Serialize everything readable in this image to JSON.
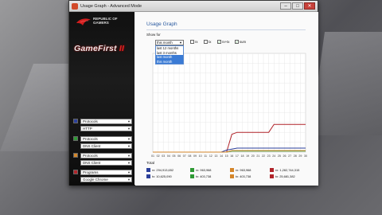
{
  "window": {
    "title": "Usage Graph - Advanced Mode",
    "minimize": "–",
    "maximize": "□",
    "close": "✕"
  },
  "brand": {
    "line1": "REPUBLIC OF",
    "line2": "GAMERS",
    "product": "GameFirst",
    "product_suffix": "II"
  },
  "slots": [
    {
      "color": "#2b3f9a",
      "category": "Protocols",
      "item": "HTTP"
    },
    {
      "color": "#2f9a35",
      "category": "Protocols",
      "item": "DNS Client"
    },
    {
      "color": "#d4862a",
      "category": "Protocols",
      "item": "DNS Client"
    },
    {
      "color": "#b0242a",
      "category": "Programs",
      "item": "Google Chrome"
    }
  ],
  "main": {
    "heading": "Usage Graph",
    "show_for": "Show for",
    "period_selected": "this month",
    "period_options": [
      "last 12 months",
      "last 3 months",
      "last month",
      "this month"
    ],
    "checkboxes": [
      {
        "label": "rx",
        "checked": false
      },
      {
        "label": "tx",
        "checked": false
      },
      {
        "label": "rx+tx",
        "checked": true
      },
      {
        "label": "sum",
        "checked": true
      }
    ],
    "total_label": "Total",
    "totals": [
      {
        "color": "#2b3f9a",
        "rx": "rx: 294,913,652",
        "tx": "tx: 10,625,090"
      },
      {
        "color": "#2f9a35",
        "rx": "rx: 963,968",
        "tx": "tx: 403,738"
      },
      {
        "color": "#d4862a",
        "rx": "rx: 963,968",
        "tx": "tx: 403,738"
      },
      {
        "color": "#b0242a",
        "rx": "rx: 1,282,744,315",
        "tx": "tx: 25,681,382"
      }
    ]
  },
  "chart_data": {
    "type": "line",
    "x": [
      "01",
      "02",
      "03",
      "04",
      "05",
      "06",
      "07",
      "08",
      "09",
      "10",
      "11",
      "12",
      "13",
      "14",
      "15",
      "16",
      "17",
      "18",
      "19",
      "20",
      "21",
      "22",
      "23",
      "24",
      "25",
      "26",
      "27",
      "28",
      "29",
      "30"
    ],
    "ylim": [
      0,
      100
    ],
    "grid": true,
    "series": [
      {
        "color": "#b0242a",
        "values": [
          0,
          0,
          0,
          0,
          0,
          0,
          0,
          0,
          0,
          0,
          0,
          0,
          0,
          0,
          0,
          18,
          20,
          20,
          20,
          20,
          20,
          20,
          20,
          28,
          28,
          28,
          28,
          28,
          28,
          28
        ]
      },
      {
        "color": "#2b3f9a",
        "values": [
          0,
          0,
          0,
          0,
          0,
          0,
          0,
          0,
          0,
          0,
          0,
          0,
          0,
          0,
          2,
          3,
          4,
          4,
          4,
          4,
          4,
          4,
          4,
          4,
          4,
          4,
          4,
          4,
          4,
          4
        ]
      },
      {
        "color": "#2f9a35",
        "values": [
          0,
          0,
          0,
          0,
          0,
          0,
          0,
          0,
          0,
          0,
          0,
          0,
          0,
          0,
          0,
          1,
          1,
          1,
          1,
          1,
          1,
          1,
          1,
          1,
          1,
          1,
          1,
          1,
          1,
          1
        ]
      },
      {
        "color": "#d4862a",
        "values": [
          0,
          0,
          0,
          0,
          0,
          0,
          0,
          0,
          0,
          0,
          0,
          0,
          0,
          0,
          0,
          1.5,
          1.5,
          1.5,
          1.5,
          1.5,
          1.5,
          1.5,
          1.5,
          1.5,
          1.5,
          1.5,
          1.5,
          1.5,
          1.5,
          1.5
        ]
      }
    ]
  }
}
